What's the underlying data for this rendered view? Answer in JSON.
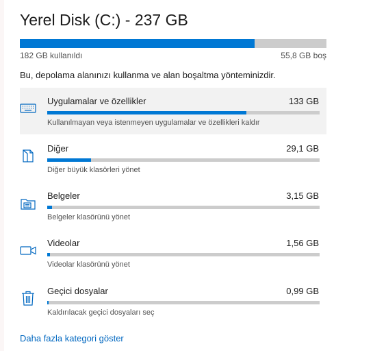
{
  "header": {
    "title": "Yerel Disk (C:) - 237 GB"
  },
  "total": {
    "used_label": "182 GB kullanıldı",
    "free_label": "55,8 GB boş",
    "used_fraction": 0.765
  },
  "description": "Bu, depolama alanınızı kullanma ve alan boşaltma yönteminizdir.",
  "categories": [
    {
      "name": "Uygulamalar ve özellikler",
      "size": "133 GB",
      "subtitle": "Kullanılmayan veya istenmeyen uygulamalar ve özellikleri kaldır",
      "fraction": 0.73,
      "icon": "keyboard-icon"
    },
    {
      "name": "Diğer",
      "size": "29,1 GB",
      "subtitle": "Diğer büyük klasörleri yönet",
      "fraction": 0.16,
      "icon": "other-files-icon"
    },
    {
      "name": "Belgeler",
      "size": "3,15 GB",
      "subtitle": "Belgeler klasörünü yönet",
      "fraction": 0.018,
      "icon": "documents-folder-icon"
    },
    {
      "name": "Videolar",
      "size": "1,56 GB",
      "subtitle": "Videolar klasörünü yönet",
      "fraction": 0.009,
      "icon": "video-camera-icon"
    },
    {
      "name": "Geçici dosyalar",
      "size": "0,99 GB",
      "subtitle": "Kaldırılacak geçici dosyaları seç",
      "fraction": 0.006,
      "icon": "trash-icon"
    }
  ],
  "more_link": "Daha fazla kategori göster",
  "colors": {
    "accent": "#0078d4",
    "track": "#cccccc",
    "selected_bg": "#f2f2f2",
    "link": "#0067c0"
  }
}
